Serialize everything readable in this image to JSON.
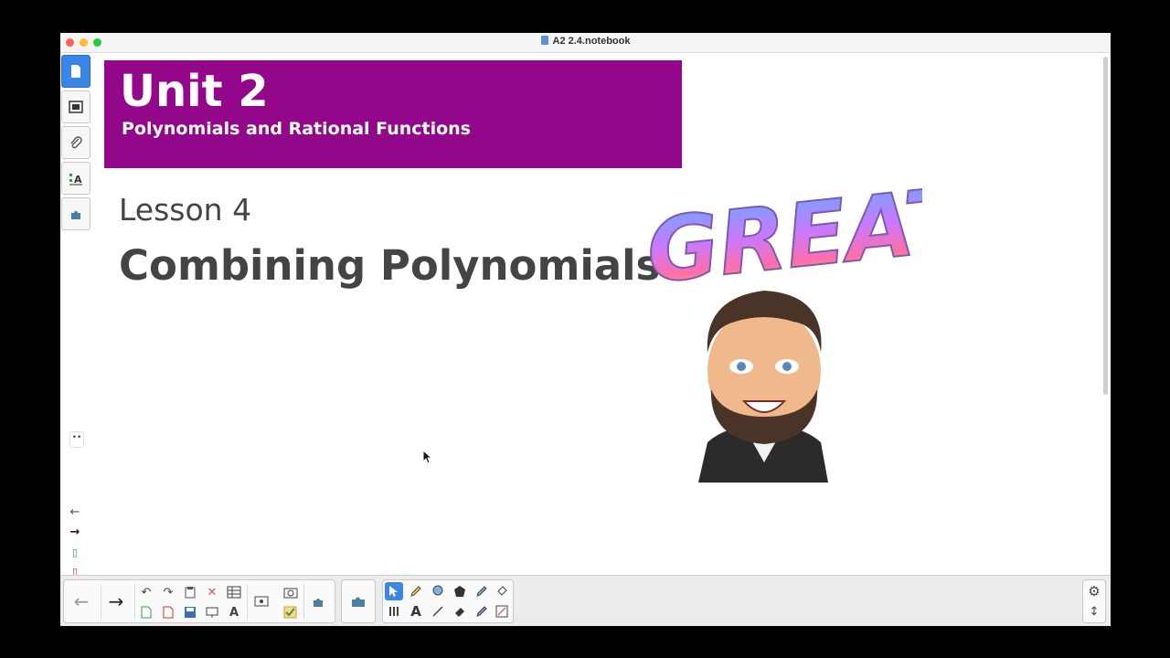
{
  "window": {
    "title": "A2 2.4.notebook"
  },
  "slide": {
    "unit": "Unit 2",
    "unit_title": "Polynomials and Rational Functions",
    "lesson": "Lesson 4",
    "lesson_title": "Combining Polynomials",
    "banner_color": "#93088a",
    "sticker_text": "GREAT!"
  },
  "sidebar": {
    "tabs": [
      "page-sorter-icon",
      "gallery-icon",
      "attachments-icon",
      "properties-icon",
      "addons-icon"
    ],
    "collapse": "••",
    "page_nav": [
      "←",
      "→"
    ]
  },
  "toolbar": {
    "undo": "↶",
    "redo": "↷",
    "delete": "✕",
    "pen_label": "A"
  }
}
